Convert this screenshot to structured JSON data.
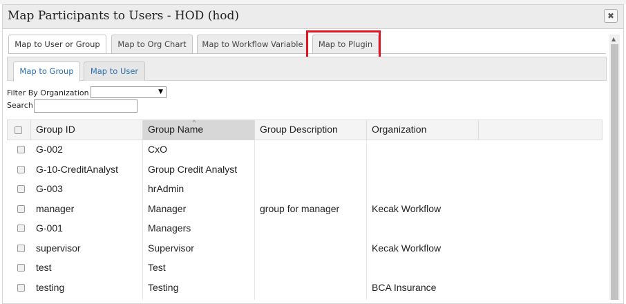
{
  "dialog": {
    "title": "Map Participants to Users - HOD (hod)",
    "close_label": "✖"
  },
  "outer_tabs": [
    {
      "label": "Map to User or Group",
      "active": true
    },
    {
      "label": "Map to Org Chart",
      "active": false
    },
    {
      "label": "Map to Workflow Variable",
      "active": false
    },
    {
      "label": "Map to Plugin",
      "active": false
    }
  ],
  "inner_tabs": [
    {
      "label": "Map to Group",
      "active": true
    },
    {
      "label": "Map to User",
      "active": false
    }
  ],
  "filter": {
    "label": "Filter By Organization",
    "selected": "",
    "arrow": "▼"
  },
  "search": {
    "label": "Search",
    "value": ""
  },
  "table": {
    "columns": [
      "Group ID",
      "Group Name",
      "Group Description",
      "Organization"
    ],
    "sort_indicator": "^",
    "rows": [
      [
        "G-002",
        "CxO",
        "",
        ""
      ],
      [
        "G-10-CreditAnalyst",
        "Group Credit Analyst",
        "",
        ""
      ],
      [
        "G-003",
        "hrAdmin",
        "",
        ""
      ],
      [
        "manager",
        "Manager",
        "group for manager",
        "Kecak Workflow"
      ],
      [
        "G-001",
        "Managers",
        "",
        ""
      ],
      [
        "supervisor",
        "Supervisor",
        "",
        "Kecak Workflow"
      ],
      [
        "test",
        "Test",
        "",
        ""
      ],
      [
        "testing",
        "Testing",
        "",
        "BCA Insurance"
      ]
    ]
  },
  "scrollbar": {
    "up_arrow": "▲"
  },
  "colors": {
    "highlight": "#e0141e",
    "tab_link": "#2a6fb0",
    "sorted_header": "#d7d7d7"
  }
}
